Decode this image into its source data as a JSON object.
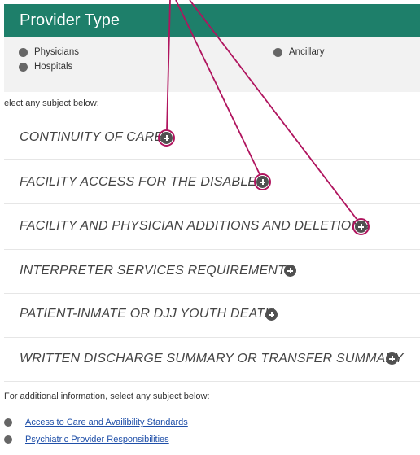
{
  "header": {
    "title": "Provider Type"
  },
  "provider_types": [
    {
      "label": "Physicians"
    },
    {
      "label": "Ancillary"
    },
    {
      "label": "Hospitals"
    }
  ],
  "instructions": "elect any subject below:",
  "subjects": [
    {
      "label": "CONTINUITY OF CARE"
    },
    {
      "label": "FACILITY ACCESS FOR THE DISABLED"
    },
    {
      "label": "FACILITY AND PHYSICIAN ADDITIONS AND DELETIONS"
    },
    {
      "label": "INTERPRETER SERVICES REQUIREMENTS"
    },
    {
      "label": "PATIENT-INMATE OR DJJ YOUTH DEATH"
    },
    {
      "label": "WRITTEN DISCHARGE SUMMARY OR TRANSFER SUMMARY"
    }
  ],
  "more_info": "For additional information, select any subject below:",
  "links": [
    {
      "label": "Access to Care and Availibility Standards"
    },
    {
      "label": "Psychiatric Provider Responsibilities"
    }
  ],
  "colors": {
    "header": "#1e7f6a",
    "annotation": "#b0145e",
    "link": "#1f4fa8"
  },
  "icons": {
    "expand": "plus-circle-icon",
    "radio": "radio-dot-icon",
    "bullet": "bullet-dot-icon"
  }
}
